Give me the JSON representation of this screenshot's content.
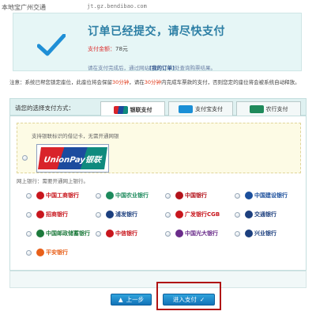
{
  "watermark": {
    "site": "本地宝广州交通",
    "url": "jt.gz.bendibao.com"
  },
  "confirm": {
    "title": "订单已经提交，请尽快支付",
    "amount_label": "支付金额：",
    "amount_value": "78元",
    "note_before": "请在支付完成后，通过网站",
    "note_link": "[我的订单]",
    "note_after": "处查询购票结果。"
  },
  "notice": {
    "part1": "注意：系统已帮您锁定座位，此座位将会保留",
    "minutes1": "30分钟",
    "part2": "，请在",
    "minutes2": "30分钟",
    "part3": "内完成车票款的支付，否则您定的座位将会被系统自动释放。"
  },
  "tabs": {
    "prompt": "请您的选择支付方式：",
    "items": [
      {
        "label": "银联支付",
        "logo_color": "#d9232a"
      },
      {
        "label": "支付宝支付",
        "logo_color": "#1a8fd6"
      },
      {
        "label": "农行支付",
        "logo_color": "#1f8a5b"
      }
    ]
  },
  "unionpay": {
    "hint": "支持银联标识的借记卡，无需开通网银",
    "logo_text": "UnionPay银联"
  },
  "banks": {
    "section_label": "网上银行：需要开通网上银行。",
    "items": [
      {
        "name": "中国工商银行",
        "color": "#c8161d"
      },
      {
        "name": "中国农业银行",
        "color": "#1d8a5c"
      },
      {
        "name": "中国银行",
        "color": "#b3131b"
      },
      {
        "name": "中国建设银行",
        "color": "#1b4f9c"
      },
      {
        "name": "招商银行",
        "color": "#c8161d"
      },
      {
        "name": "浦发银行",
        "color": "#1c3f7e"
      },
      {
        "name": "广发银行CGB",
        "color": "#c8161d"
      },
      {
        "name": "交通银行",
        "color": "#1c3f7e"
      },
      {
        "name": "中国邮政储蓄银行",
        "color": "#1d7a3c"
      },
      {
        "name": "中信银行",
        "color": "#c8161d"
      },
      {
        "name": "中国光大银行",
        "color": "#6a2c8a"
      },
      {
        "name": "兴业银行",
        "color": "#1c3f7e"
      },
      {
        "name": "平安银行",
        "color": "#e8601a"
      }
    ]
  },
  "buttons": {
    "prev": "上一步",
    "pay": "进入支付"
  }
}
